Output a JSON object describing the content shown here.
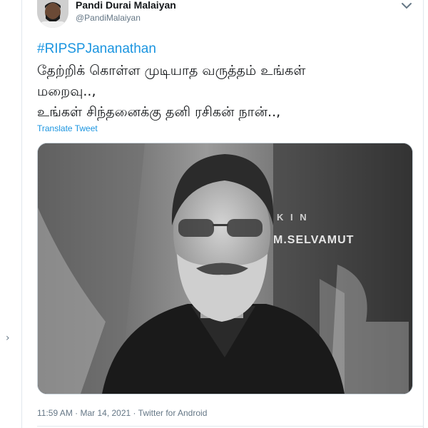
{
  "tweet": {
    "author_name": "Pandi Durai Malaiyan",
    "author_handle": "@PandiMalaiyan",
    "hashtag": "#RIPSPJananathan",
    "text_lines": [
      "தேற்றிக் கொள்ள முடியாத வருத்தம் உங்கள்",
      "மறைவு..,",
      "உங்கள் சிந்தனைக்கு தனி ரசிகன் நான்..,"
    ],
    "translate_label": "Translate Tweet",
    "timestamp": "11:59 AM · Mar 14, 2021",
    "source": "Twitter for Android",
    "media_backdrop_text": "M.SELVAMUT",
    "media_backdrop_text_top": "K I N"
  },
  "colors": {
    "link": "#1b95e0",
    "text": "#14171a",
    "secondary": "#657786"
  },
  "icons": {
    "more": "chevron-down-icon",
    "avatar": "avatar"
  }
}
